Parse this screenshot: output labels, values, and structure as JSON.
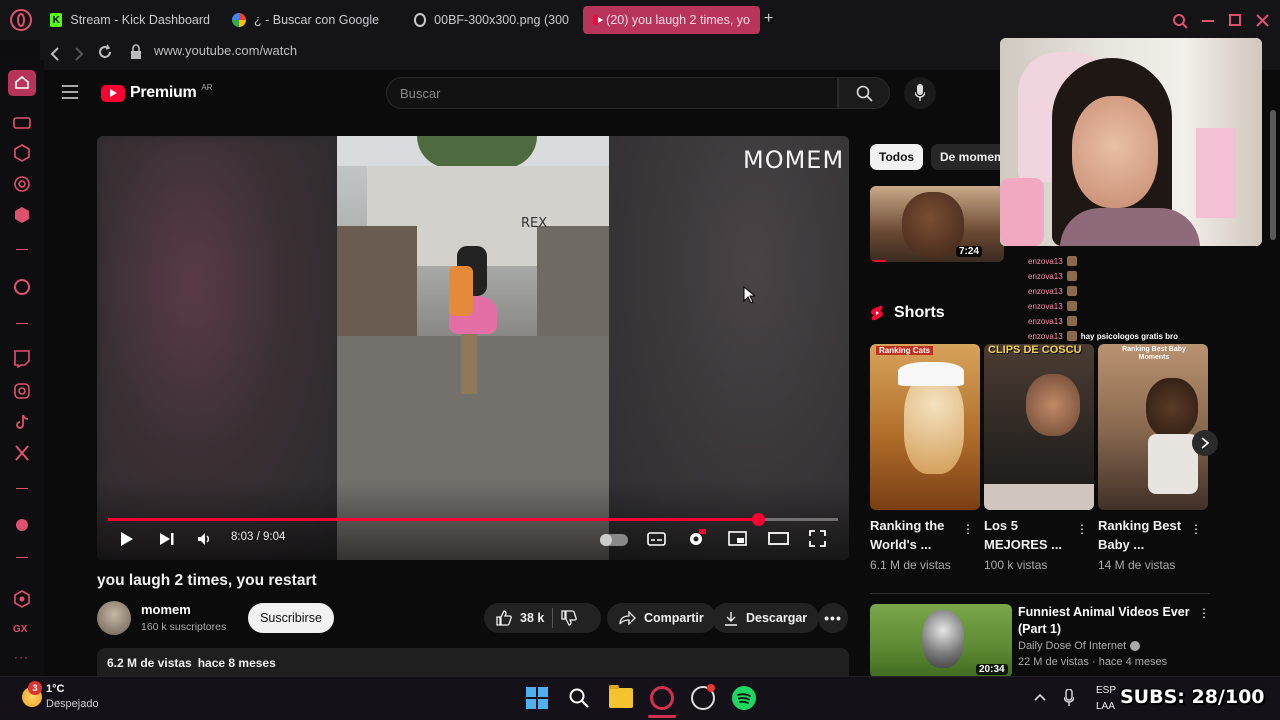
{
  "browser": {
    "tabs": [
      {
        "label": "Stream - Kick Dashboard",
        "icon": "kick-icon",
        "active": false
      },
      {
        "label": "¿ - Buscar con Google",
        "icon": "google-icon",
        "active": false
      },
      {
        "label": "00BF-300x300.png (300",
        "icon": "image-icon",
        "active": false
      },
      {
        "label": "(20) you laugh 2 times, yo",
        "icon": "youtube-icon",
        "active": true
      }
    ],
    "url": "www.youtube.com/watch",
    "accent": "#b8345a"
  },
  "youtube": {
    "logo_text": "Premium",
    "logo_region": "AR",
    "search_placeholder": "Buscar",
    "video": {
      "watermark": "MOMEM",
      "time_current": "8:03",
      "time_total": "9:04",
      "time_sep": " / ",
      "progress": 0.89,
      "title": "you laugh 2 times, you restart"
    },
    "channel": {
      "name": "momem",
      "subscribers": "160 k suscriptores",
      "subscribe_label": "Suscribirse"
    },
    "actions": {
      "likes": "38 k",
      "share": "Compartir",
      "download": "Descargar"
    },
    "description": {
      "views": "6.2 M de vistas",
      "date": "hace 8 meses"
    },
    "chips": [
      {
        "label": "Todos",
        "selected": true
      },
      {
        "label": "De momem",
        "selected": false
      }
    ],
    "suggested_top": {
      "duration": "7:24"
    },
    "shorts_heading": "Shorts",
    "shorts": [
      {
        "title_l1": "Ranking the",
        "title_l2": "World's ...",
        "views": "6.1 M de vistas",
        "caption": "Ranking Cats"
      },
      {
        "title_l1": "Los 5",
        "title_l2": "MEJORES ...",
        "views": "100 k vistas",
        "caption": "CLIPS DE COSCU"
      },
      {
        "title_l1": "Ranking Best",
        "title_l2": "Baby ...",
        "views": "14 M de vistas",
        "caption": "Ranking Best Baby Moments"
      }
    ],
    "suggested_video": {
      "title_l1": "Funniest Animal Videos Ever",
      "title_l2": "(Part 1)",
      "channel": "Daily Dose Of Internet",
      "meta": "22 M de vistas · hace 4 meses",
      "duration": "20:34"
    }
  },
  "stream_overlay": {
    "chat": [
      {
        "user": "enzova13",
        "msg": ""
      },
      {
        "user": "enzova13",
        "msg": ""
      },
      {
        "user": "enzova13",
        "msg": ""
      },
      {
        "user": "enzova13",
        "msg": ""
      },
      {
        "user": "enzova13",
        "msg": ""
      },
      {
        "user": "enzova13",
        "msg": "hay psicologos gratis bro"
      }
    ],
    "subs_label": "SUBS: 28/100"
  },
  "taskbar": {
    "weather_temp": "1°C",
    "weather_desc": "Despejado",
    "notif_count": "3",
    "lang_top": "ESP",
    "lang_bottom": "LAA"
  }
}
